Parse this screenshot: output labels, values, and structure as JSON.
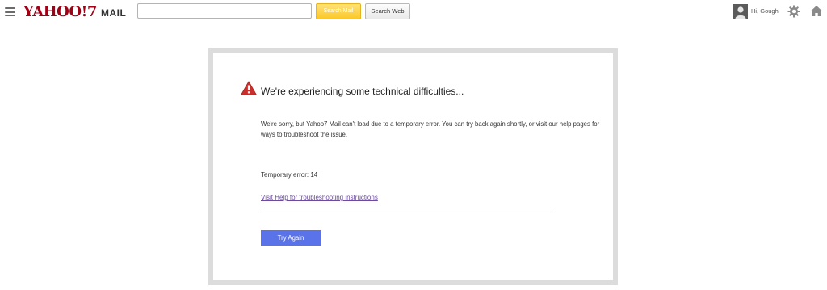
{
  "header": {
    "logo_text": "YAHOO!7",
    "logo_product": "MAIL",
    "search_placeholder": "",
    "search_mail_label": "Search Mail",
    "search_web_label": "Search Web",
    "greeting": "Hi, Gough"
  },
  "icons": {
    "menu": "menu-icon",
    "avatar": "user-avatar-icon",
    "settings": "gear-icon",
    "home": "home-icon",
    "warning": "warning-icon"
  },
  "error": {
    "title": "We're experiencing some technical difficulties...",
    "message": "We're sorry, but Yahoo7 Mail can't load due to a temporary error. You can try back again shortly, or visit our help pages for ways to troubleshoot the issue.",
    "code": "Temporary error: 14",
    "help_link": "Visit Help for troubleshooting instructions",
    "retry_label": "Try Again"
  },
  "colors": {
    "brand": "#a30016",
    "search_mail_button": "#fbc829",
    "primary_button": "#5b73e8",
    "warning": "#c9302c",
    "link": "#6b4aa0",
    "card_border": "#dcdcdc"
  }
}
